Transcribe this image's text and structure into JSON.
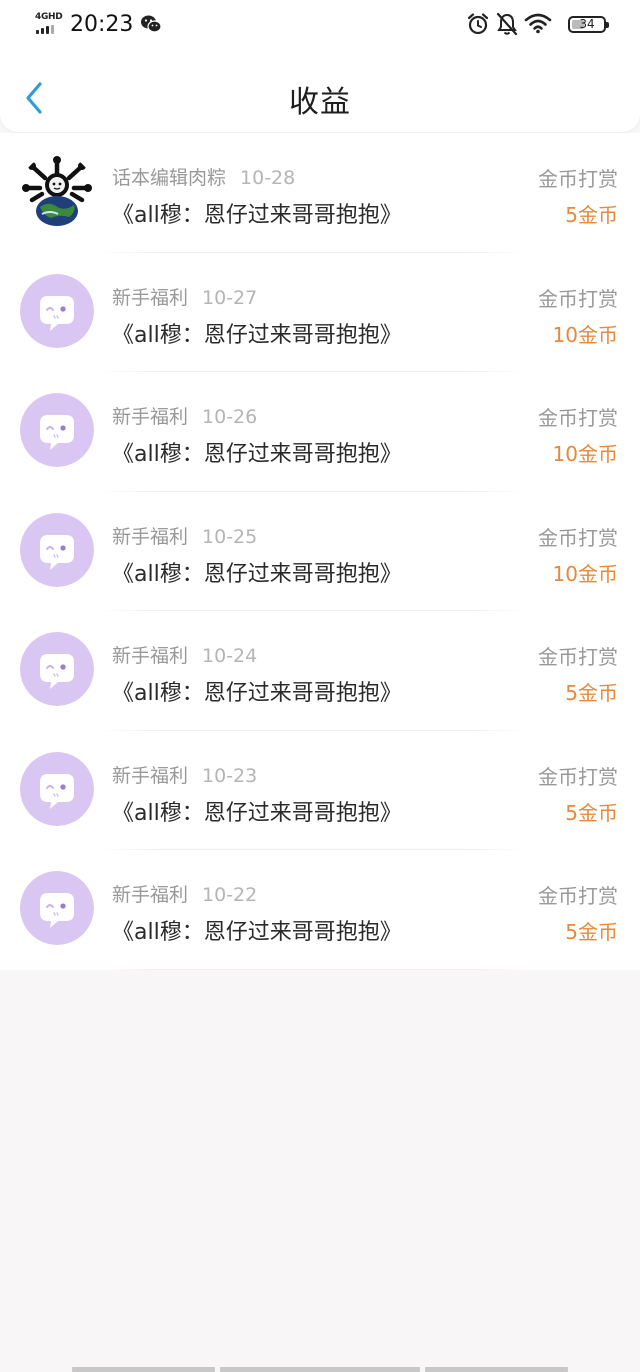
{
  "status_bar": {
    "network": "4GHD",
    "time": "20:23",
    "battery": "34",
    "battery_fraction": 0.34
  },
  "nav": {
    "back_icon": "chevron-left-icon",
    "title": "收益"
  },
  "colors": {
    "accent_blue": "#2d9cdb",
    "amount_orange": "#e8883a",
    "avatar_purple": "#d9c6f2"
  },
  "records": [
    {
      "source": "话本编辑肉粽",
      "date": "10-28",
      "book": "《all穆：恩仔过来哥哥抱抱》",
      "type": "金币打赏",
      "amount": "5金币",
      "avatar": "editor"
    },
    {
      "source": "新手福利",
      "date": "10-27",
      "book": "《all穆：恩仔过来哥哥抱抱》",
      "type": "金币打赏",
      "amount": "10金币",
      "avatar": "chat-bubble"
    },
    {
      "source": "新手福利",
      "date": "10-26",
      "book": "《all穆：恩仔过来哥哥抱抱》",
      "type": "金币打赏",
      "amount": "10金币",
      "avatar": "chat-bubble"
    },
    {
      "source": "新手福利",
      "date": "10-25",
      "book": "《all穆：恩仔过来哥哥抱抱》",
      "type": "金币打赏",
      "amount": "10金币",
      "avatar": "chat-bubble"
    },
    {
      "source": "新手福利",
      "date": "10-24",
      "book": "《all穆：恩仔过来哥哥抱抱》",
      "type": "金币打赏",
      "amount": "5金币",
      "avatar": "chat-bubble"
    },
    {
      "source": "新手福利",
      "date": "10-23",
      "book": "《all穆：恩仔过来哥哥抱抱》",
      "type": "金币打赏",
      "amount": "5金币",
      "avatar": "chat-bubble"
    },
    {
      "source": "新手福利",
      "date": "10-22",
      "book": "《all穆：恩仔过来哥哥抱抱》",
      "type": "金币打赏",
      "amount": "5金币",
      "avatar": "chat-bubble"
    }
  ]
}
